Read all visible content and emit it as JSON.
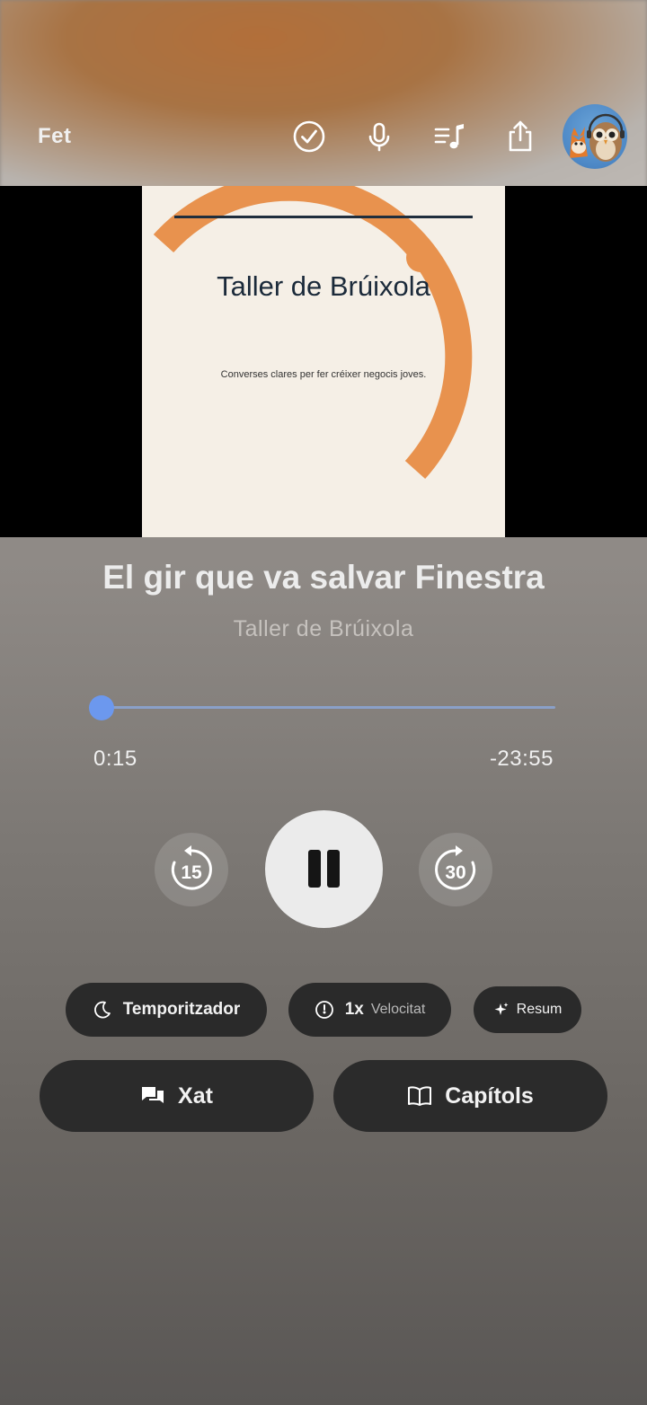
{
  "topbar": {
    "done_label": "Fet",
    "icons": [
      "checkmark-circle-icon",
      "microphone-icon",
      "playlist-icon",
      "share-icon",
      "avatar"
    ]
  },
  "cover": {
    "title": "Taller de Brúixola",
    "subtitle": "Converses clares per fer créixer negocis joves.",
    "accent_color": "#e8924e",
    "text_color": "#1b2a3a"
  },
  "episode": {
    "title": "El gir que va salvar Finestra",
    "show": "Taller de Brúixola"
  },
  "progress": {
    "elapsed": "0:15",
    "remaining": "-23:55",
    "fraction": 0.01
  },
  "controls": {
    "skip_back": "15",
    "skip_forward": "30",
    "state": "playing"
  },
  "pills": {
    "timer_label": "Temporitzador",
    "speed_value": "1x",
    "speed_label": "Velocitat",
    "summary_label": "Resum"
  },
  "actions": {
    "chat_label": "Xat",
    "chapters_label": "Capítols"
  },
  "colors": {
    "progress_accent": "#6c98ee",
    "pill_bg": "#2a2a2a"
  }
}
